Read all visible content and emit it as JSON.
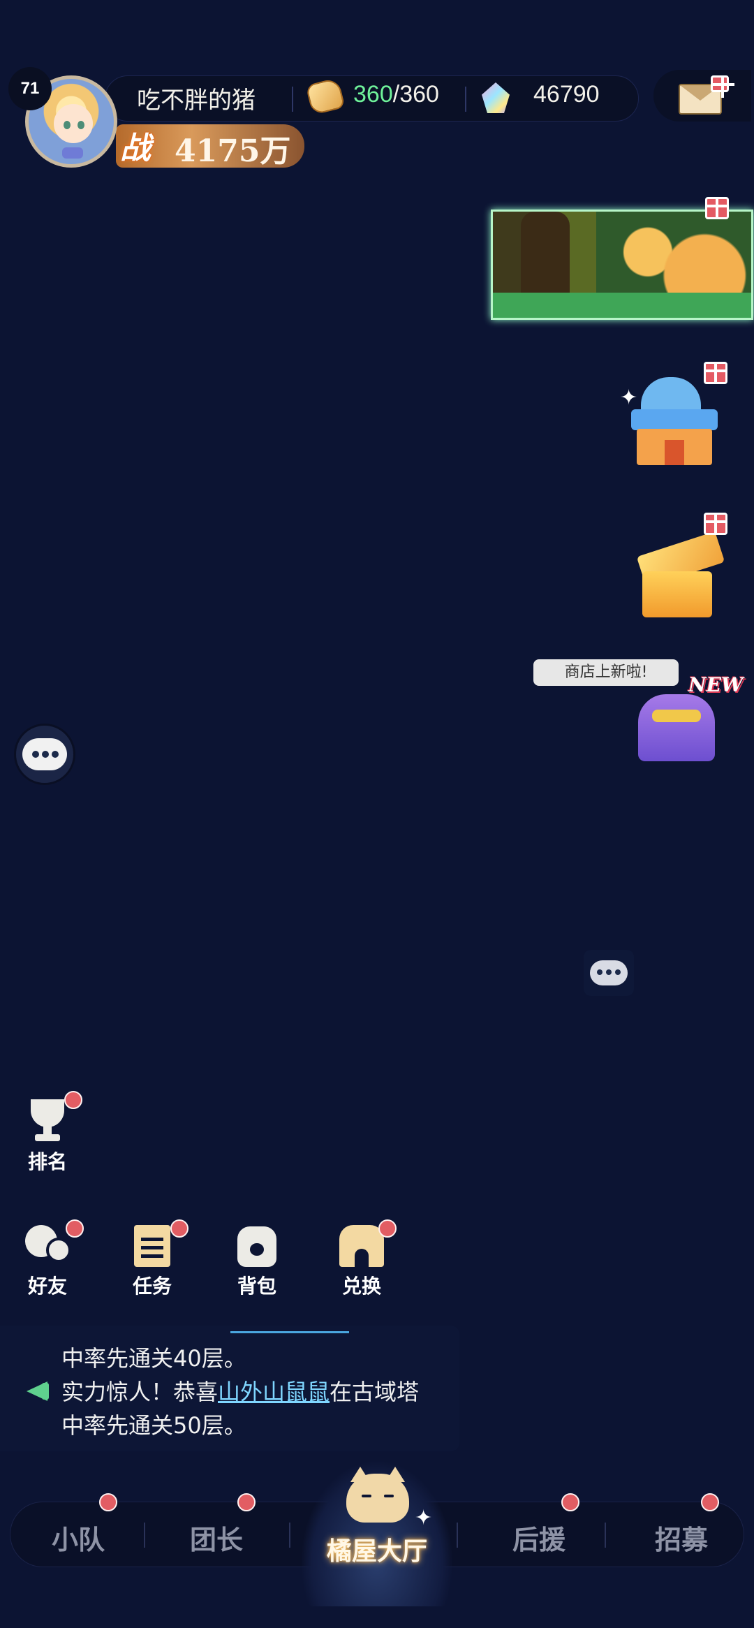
{
  "player": {
    "level": "71",
    "nickname": "吃不胖的猪",
    "stamina_current": "360",
    "stamina_separator": "/",
    "stamina_max": "360",
    "gems": "46790",
    "power_label": "战",
    "power_value": "4175万"
  },
  "right_widgets": {
    "shop_bubble": "商店上新啦!",
    "new_badge": "NEW"
  },
  "functions": {
    "ranking": "排名",
    "friends": "好友",
    "tasks": "任务",
    "bag": "背包",
    "exchange": "兑换"
  },
  "news": {
    "line1": "中率先通关40层。",
    "line2_prefix": "实力惊人！恭喜",
    "line2_name": "山外山鼠鼠",
    "line2_suffix": "在古域塔",
    "line3": "中率先通关50层。"
  },
  "bottom_nav": {
    "team": "小队",
    "leader": "团长",
    "hall": "橘屋大厅",
    "support": "后援",
    "recruit": "招募"
  },
  "colors": {
    "background": "#0c1433",
    "stamina_current": "#6ff29a",
    "notification_dot": "#e25d63",
    "news_highlight": "#7fd6ff"
  }
}
